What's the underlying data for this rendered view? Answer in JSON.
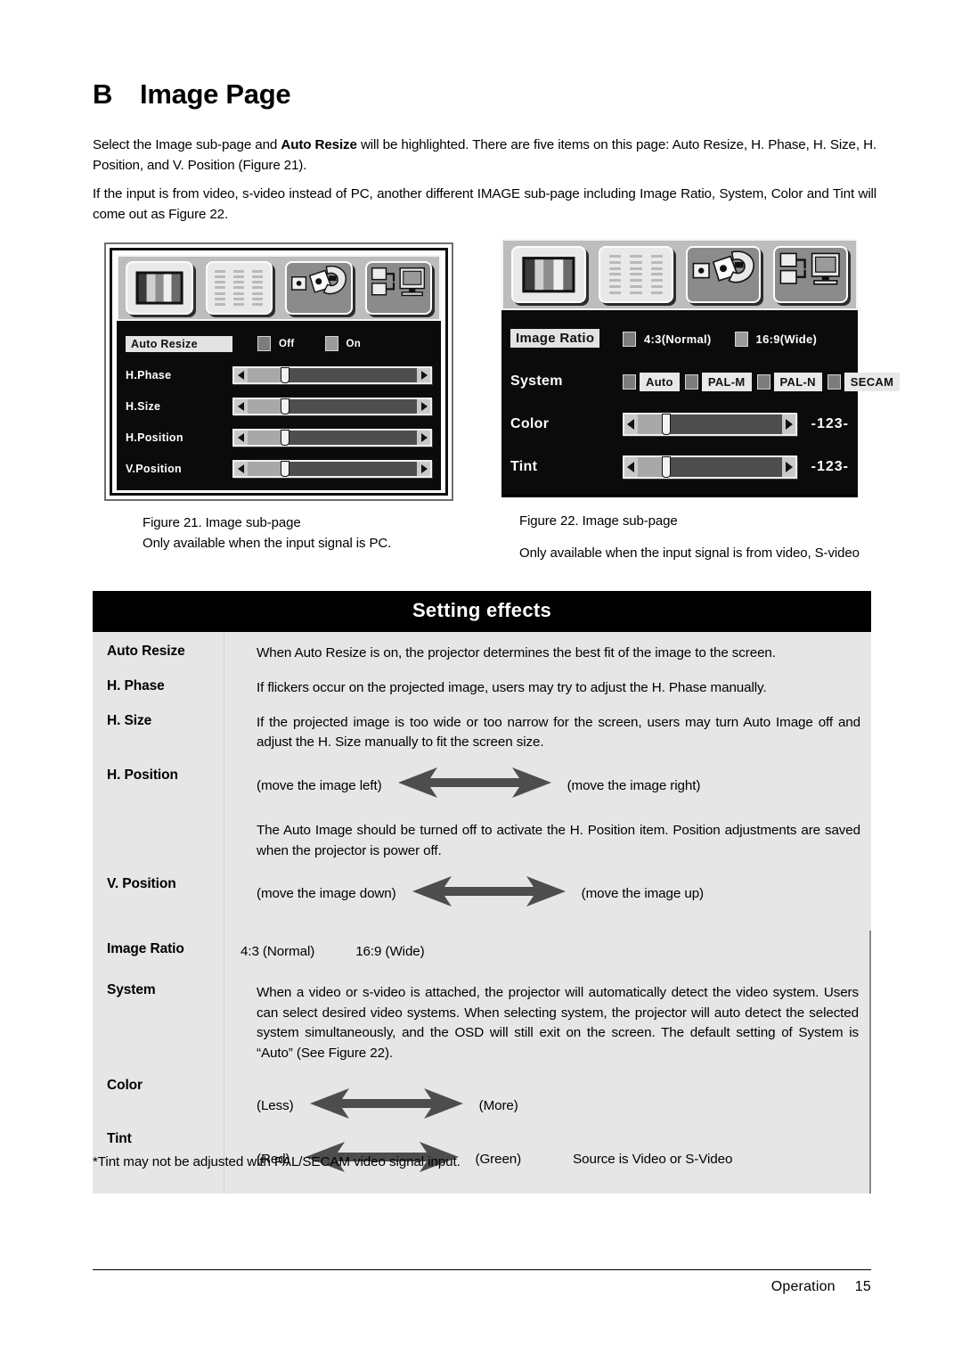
{
  "heading": {
    "letter": "B",
    "title": "Image Page"
  },
  "intro": {
    "p1_before": "Select the Image sub-page and ",
    "p1_bold": "Auto Resize",
    "p1_after": " will be highlighted. There are five items on this page: Auto Resize, H. Phase, H. Size, H. Position, and V. Position (Figure 21).",
    "p2": "If the input is from video, s-video instead of PC, another different IMAGE sub-page including Image Ratio, System, Color and Tint will come out as Figure 22."
  },
  "figure21": {
    "caption_title": "Figure 21. Image sub-page",
    "caption_note": "Only available when the input signal is PC.",
    "osd": {
      "icons": [
        "color-bars-icon",
        "text-page-icon",
        "hand-image-icon",
        "computer-connection-icon"
      ],
      "rows": [
        {
          "label": "Auto Resize",
          "highlight": true,
          "type": "options",
          "options": [
            {
              "label": "Off",
              "checked": false
            },
            {
              "label": "On",
              "checked": false
            }
          ]
        },
        {
          "label": "H.Phase",
          "highlight": false,
          "type": "slider",
          "fill": 22
        },
        {
          "label": "H.Size",
          "highlight": false,
          "type": "slider",
          "fill": 22
        },
        {
          "label": "H.Position",
          "highlight": false,
          "type": "slider",
          "fill": 22
        },
        {
          "label": "V.Position",
          "highlight": false,
          "type": "slider",
          "fill": 22
        }
      ]
    }
  },
  "figure22": {
    "caption_title": "Figure 22. Image sub-page",
    "caption_note": "Only available when the input signal is from video, S-video",
    "osd": {
      "icons": [
        "color-bars-icon",
        "text-page-icon",
        "hand-image-icon",
        "computer-connection-icon"
      ],
      "image_ratio": {
        "label": "Image Ratio",
        "options": [
          {
            "label": "4:3(Normal)"
          },
          {
            "label": "16:9(Wide)"
          }
        ]
      },
      "system": {
        "label": "System",
        "options": [
          {
            "label": "Auto"
          },
          {
            "label": "PAL-M"
          },
          {
            "label": "PAL-N"
          },
          {
            "label": "SECAM"
          }
        ]
      },
      "color": {
        "label": "Color",
        "value": "-123-",
        "fill": 20
      },
      "tint": {
        "label": "Tint",
        "value": "-123-",
        "fill": 20
      }
    }
  },
  "table_a": {
    "header": "Setting effects",
    "rows": [
      {
        "key": "Auto Resize",
        "type": "text",
        "paragraphs": [
          "When Auto Resize is on, the projector determines the best fit of the image to the screen."
        ]
      },
      {
        "key": "H. Phase",
        "type": "text",
        "paragraphs": [
          "If flickers occur on the projected image, users may try to adjust the H. Phase manually."
        ]
      },
      {
        "key": "H. Size",
        "type": "text",
        "paragraphs": [
          "If the projected image is too wide or too narrow for the screen, users may turn Auto Image off and adjust the H. Size manually to fit the screen size."
        ]
      },
      {
        "key": "H. Position",
        "type": "arrow",
        "arrow_left": "(move the image left)",
        "arrow_right": "(move the image right)",
        "paragraphs": [
          "The Auto Image should be turned off to activate the H. Position item. Position adjustments are saved when the projector is power off."
        ]
      },
      {
        "key": "V. Position",
        "type": "arrow",
        "arrow_left": "(move the image down)",
        "arrow_right": "(move the image up)",
        "paragraphs": [
          "Position adjustments are saved when the projector is power off."
        ]
      }
    ]
  },
  "table_b": {
    "rows": [
      {
        "key": "Image Ratio",
        "type": "ratio",
        "options": [
          "4:3 (Normal)",
          "16:9 (Wide)"
        ]
      },
      {
        "key": "System",
        "type": "text",
        "paragraphs": [
          "When a video or s-video is attached, the projector will automatically detect the video system. Users can select desired video systems. When selecting system, the projector will auto detect the selected system simultaneously, and the OSD will still exit on the screen. The default setting of System is “Auto” (See Figure 22)."
        ]
      },
      {
        "key": "Color",
        "type": "arrow",
        "arrow_left": "(Less)",
        "arrow_right": "(More)",
        "arrow_extra": ""
      },
      {
        "key": "Tint",
        "type": "arrow",
        "arrow_left": "(Red)",
        "arrow_right": "(Green)",
        "arrow_extra": "Source is Video or S-Video"
      }
    ]
  },
  "footnote": "*Tint may not be adjusted with PAL/SECAM video signal input.",
  "footer": {
    "section": "Operation",
    "page": "15"
  }
}
